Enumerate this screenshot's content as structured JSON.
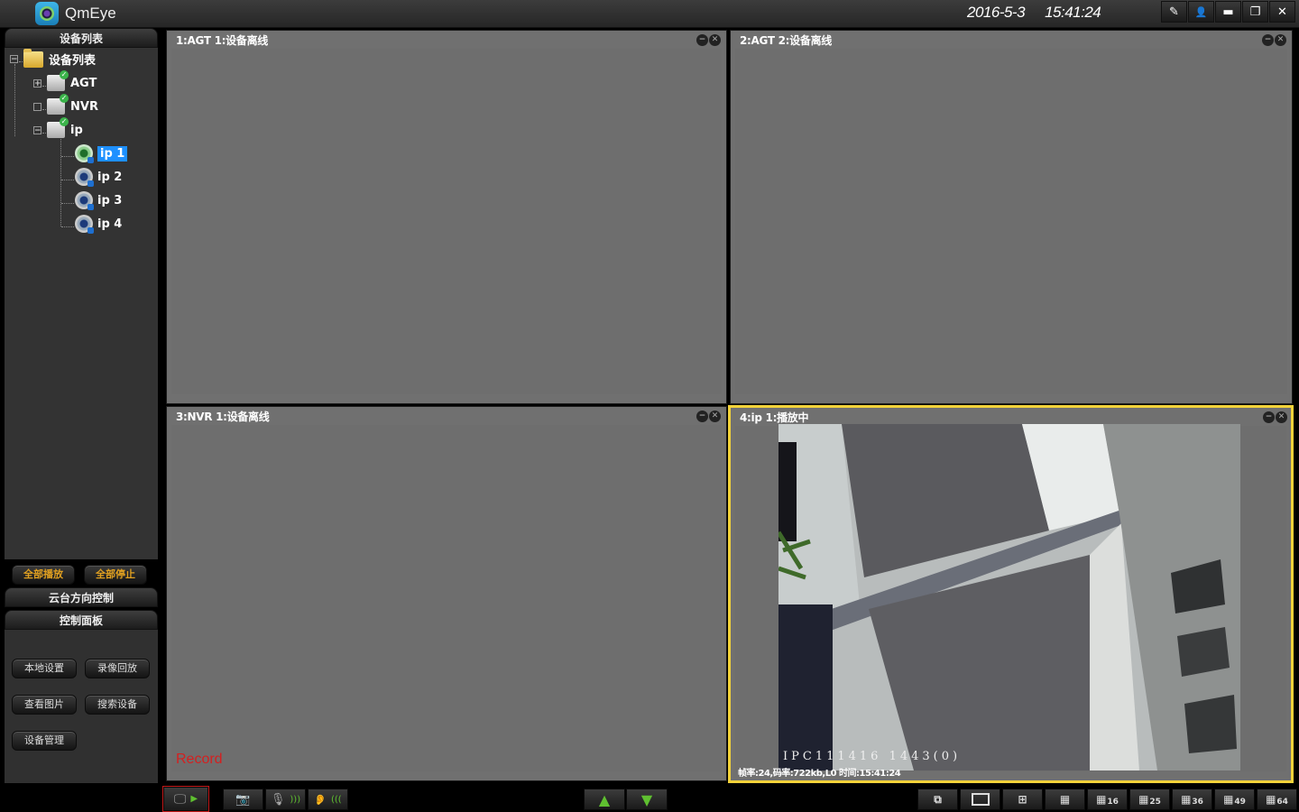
{
  "window": {
    "app_name": "QmEye",
    "date": "2016-5-3",
    "time": "15:41:24",
    "buttons": [
      {
        "name": "edit",
        "glyph": "✎"
      },
      {
        "name": "user-settings",
        "glyph": "👤"
      },
      {
        "name": "minimize",
        "glyph": "▬"
      },
      {
        "name": "restore",
        "glyph": "❐"
      },
      {
        "name": "close",
        "glyph": "✕"
      }
    ]
  },
  "sidebar": {
    "device_list_header": "设备列表",
    "tree": {
      "root": "设备列表",
      "devices": [
        {
          "label": "AGT",
          "expanded": false,
          "status": "online"
        },
        {
          "label": "NVR",
          "expanded": false,
          "status": "online"
        },
        {
          "label": "ip",
          "expanded": true,
          "status": "online",
          "channels": [
            {
              "label": "ip 1",
              "selected": true,
              "active": true
            },
            {
              "label": "ip 2",
              "selected": false,
              "active": false
            },
            {
              "label": "ip 3",
              "selected": false,
              "active": false
            },
            {
              "label": "ip 4",
              "selected": false,
              "active": false
            }
          ]
        }
      ]
    },
    "play_all": "全部播放",
    "stop_all": "全部停止",
    "ptz_header": "云台方向控制",
    "control_panel_header": "控制面板",
    "control_buttons": [
      "本地设置",
      "录像回放",
      "查看图片",
      "搜索设备",
      "设备管理"
    ],
    "expander_collapsed": "+",
    "expander_expanded": "−"
  },
  "grid": {
    "cells": [
      {
        "title": "1:AGT 1:设备离线",
        "active": false
      },
      {
        "title": "2:AGT 2:设备离线",
        "active": false
      },
      {
        "title": "3:NVR 1:设备离线",
        "active": false,
        "record_label": "Record"
      },
      {
        "title": "4:ip 1:播放中",
        "active": true,
        "osd_id": "IPC111416 1443(0)",
        "stats": "帧率:24,码率:722kb,L0 时间:15:41:24"
      }
    ],
    "cell_minimize_glyph": "−",
    "cell_close_glyph": "✕"
  },
  "toolbar": {
    "preview_play_glyph": "▶",
    "nav_up_glyph": "⌃",
    "nav_down_glyph": "⌄",
    "layouts": [
      "custom",
      "1",
      "4",
      "9",
      "16",
      "25",
      "36",
      "49",
      "64"
    ],
    "layout_badges": {
      "16": "16",
      "25": "25",
      "36": "36",
      "49": "49",
      "64": "64"
    }
  },
  "colors": {
    "active_cell_border": "#f2d23a",
    "selected_item": "#1e90ff",
    "record_text": "#d42020",
    "accent_green": "#5fc030",
    "orange_button_text": "#e0a020"
  }
}
